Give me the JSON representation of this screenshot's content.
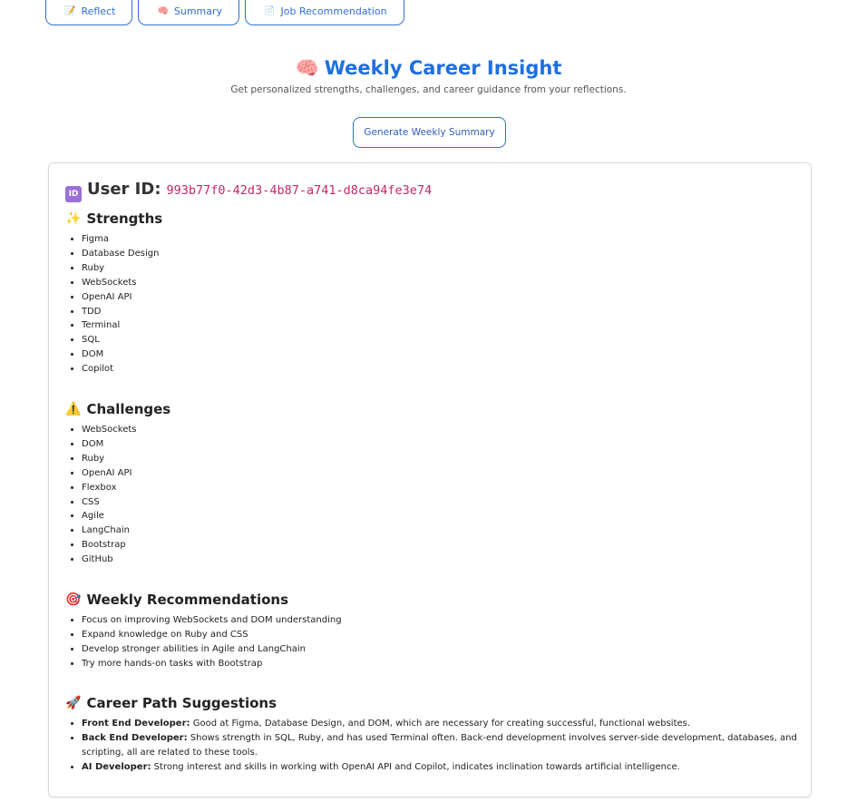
{
  "nav": [
    {
      "icon": "📝",
      "label": "Reflect"
    },
    {
      "icon": "🧠",
      "label": "Summary"
    },
    {
      "icon": "📄",
      "label": "Job Recommendation"
    }
  ],
  "header": {
    "icon": "🧠",
    "title": "Weekly Career Insight",
    "subtitle": "Get personalized strengths, challenges, and career guidance from your reflections."
  },
  "generate_button": "Generate Weekly Summary",
  "card": {
    "user_id_icon": "ID",
    "user_id_label": "User ID:",
    "user_id_value": "993b77f0-42d3-4b87-a741-d8ca94fe3e74",
    "strengths": {
      "icon": "✨",
      "title": "Strengths",
      "items": [
        "Figma",
        "Database Design",
        "Ruby",
        "WebSockets",
        "OpenAI API",
        "TDD",
        "Terminal",
        "SQL",
        "DOM",
        "Copilot"
      ]
    },
    "challenges": {
      "icon": "⚠️",
      "title": "Challenges",
      "items": [
        "WebSockets",
        "DOM",
        "Ruby",
        "OpenAI API",
        "Flexbox",
        "CSS",
        "Agile",
        "LangChain",
        "Bootstrap",
        "GitHub"
      ]
    },
    "recommendations": {
      "icon": "🎯",
      "title": "Weekly Recommendations",
      "items": [
        "Focus on improving WebSockets and DOM understanding",
        "Expand knowledge on Ruby and CSS",
        "Develop stronger abilities in Agile and LangChain",
        "Try more hands-on tasks with Bootstrap"
      ]
    },
    "career": {
      "icon": "🚀",
      "title": "Career Path Suggestions",
      "items": [
        {
          "role": "Front End Developer:",
          "text": " Good at Figma, Database Design, and DOM, which are necessary for creating successful, functional websites."
        },
        {
          "role": "Back End Developer:",
          "text": " Shows strength in SQL, Ruby, and has used Terminal often. Back-end development involves server-side development, databases, and scripting, all are related to these tools."
        },
        {
          "role": "AI Developer:",
          "text": " Strong interest and skills in working with OpenAI API and Copilot, indicates inclination towards artificial intelligence."
        }
      ]
    }
  }
}
